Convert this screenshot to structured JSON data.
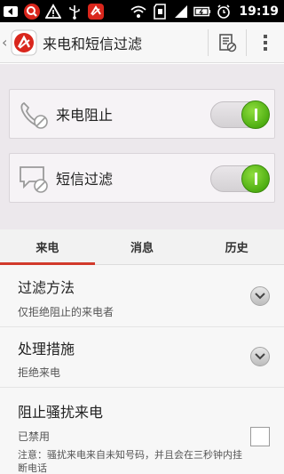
{
  "status_bar": {
    "time": "19:19",
    "icons": [
      "back-arrow-icon",
      "search-icon",
      "warning-icon",
      "usb-icon",
      "app-notification-icon",
      "wifi-icon",
      "sd-card-icon",
      "signal-icon",
      "battery-icon",
      "alarm-icon"
    ]
  },
  "app_bar": {
    "title": "来电和短信过滤",
    "back_glyph": "‹"
  },
  "toggles": [
    {
      "label": "来电阻止",
      "enabled": true
    },
    {
      "label": "短信过滤",
      "enabled": true
    }
  ],
  "tabs": [
    {
      "label": "来电",
      "active": true
    },
    {
      "label": "消息",
      "active": false
    },
    {
      "label": "历史",
      "active": false
    }
  ],
  "settings": [
    {
      "title": "过滤方法",
      "value": "仅拒绝阻止的来电者"
    },
    {
      "title": "处理措施",
      "value": "拒绝来电"
    },
    {
      "title": "阻止骚扰来电",
      "value": "已禁用",
      "note": "注意：骚扰来电来自未知号码，并且会在三秒钟内挂断电话",
      "checked": false
    }
  ],
  "colors": {
    "accent": "#d23a2c",
    "switch_on": "#4fae12"
  }
}
